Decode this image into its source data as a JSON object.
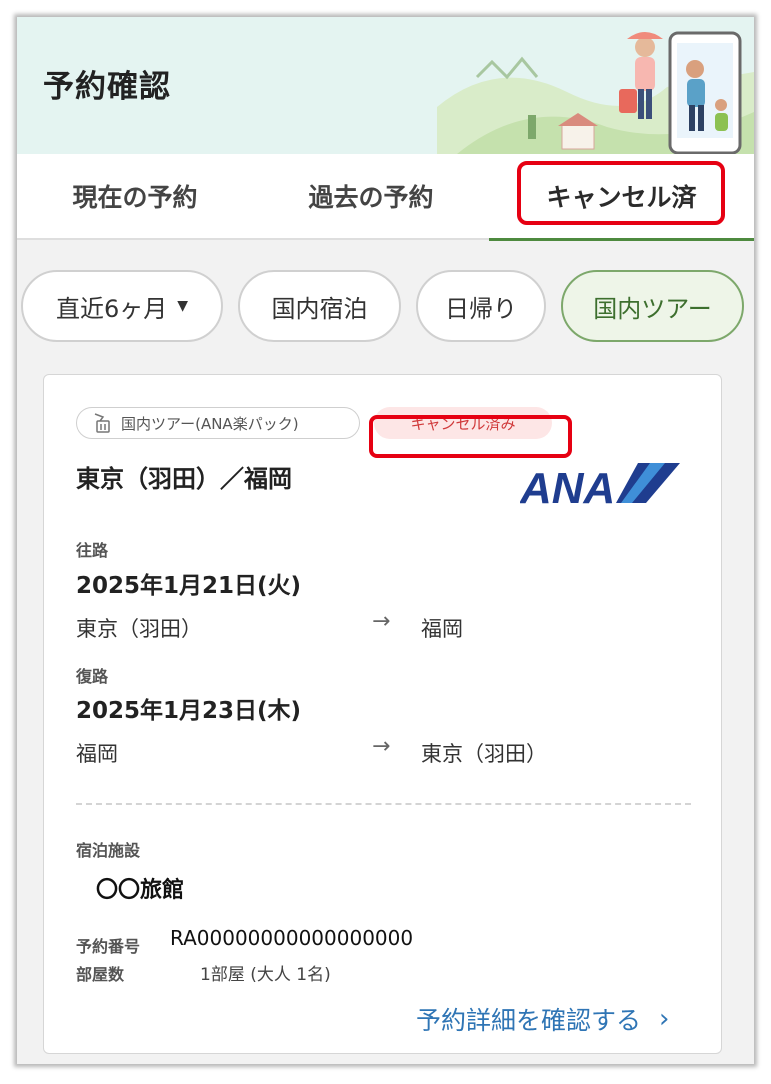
{
  "header": {
    "title": "予約確認"
  },
  "tabs": [
    {
      "label": "現在の予約"
    },
    {
      "label": "過去の予約"
    },
    {
      "label": "キャンセル済"
    }
  ],
  "filters": {
    "period": "直近6ヶ月",
    "domestic_stay": "国内宿泊",
    "day_trip": "日帰り",
    "domestic_tour": "国内ツアー"
  },
  "card": {
    "type_badge": "国内ツアー(ANA楽パック)",
    "status_badge": "キャンセル済み",
    "route_title": "東京（羽田）／福岡",
    "airline_logo": "ANA",
    "outbound": {
      "label": "往路",
      "date": "2025年1月21日(火)",
      "from": "東京（羽田）",
      "to": "福岡"
    },
    "return": {
      "label": "復路",
      "date": "2025年1月23日(木)",
      "from": "福岡",
      "to": "東京（羽田）"
    },
    "arrow": "→",
    "hotel_label": "宿泊施設",
    "hotel_name": "〇〇旅館",
    "reservation_label": "予約番号",
    "reservation_number": "RA00000000000000000",
    "rooms_label": "部屋数",
    "rooms_value": "1部屋 (大人 1名)",
    "detail_link": "予約詳細を確認する",
    "detail_chevron": "›"
  },
  "colors": {
    "accent_green": "#4e8a3f",
    "highlight_red": "#e60012",
    "link_blue": "#2f75b5",
    "ana_blue": "#1f3d8f"
  },
  "icons": [
    "luggage-icon",
    "caret-down-icon",
    "arrow-right-icon",
    "chevron-right-icon"
  ]
}
